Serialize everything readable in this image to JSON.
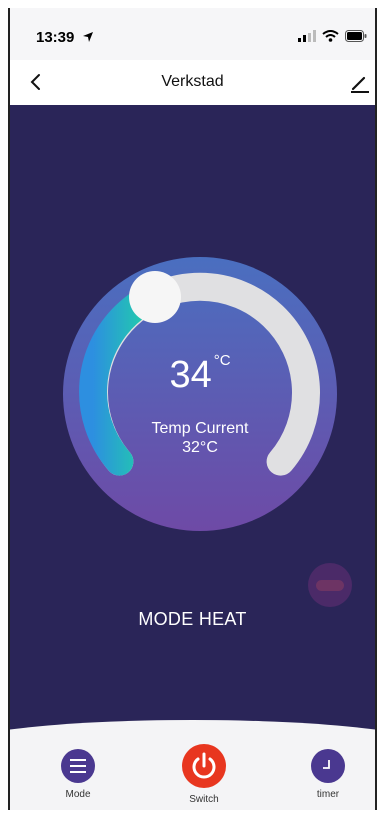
{
  "status_bar": {
    "time": "13:39"
  },
  "nav": {
    "title": "Verkstad"
  },
  "dial": {
    "set_temp": "34",
    "unit": "°C",
    "current_label": "Temp Current",
    "current_value": "32°C"
  },
  "mode": {
    "text": "MODE HEAT"
  },
  "tabs": {
    "mode": "Mode",
    "switch": "Switch",
    "timer": "timer"
  },
  "colors": {
    "background": "#2a2558",
    "dial_purple": "#6e4aa6",
    "dial_blue": "#4a6fc0",
    "power_red": "#e8361f",
    "tab_purple": "#4a3890",
    "active_arc": "#22b5b8"
  }
}
